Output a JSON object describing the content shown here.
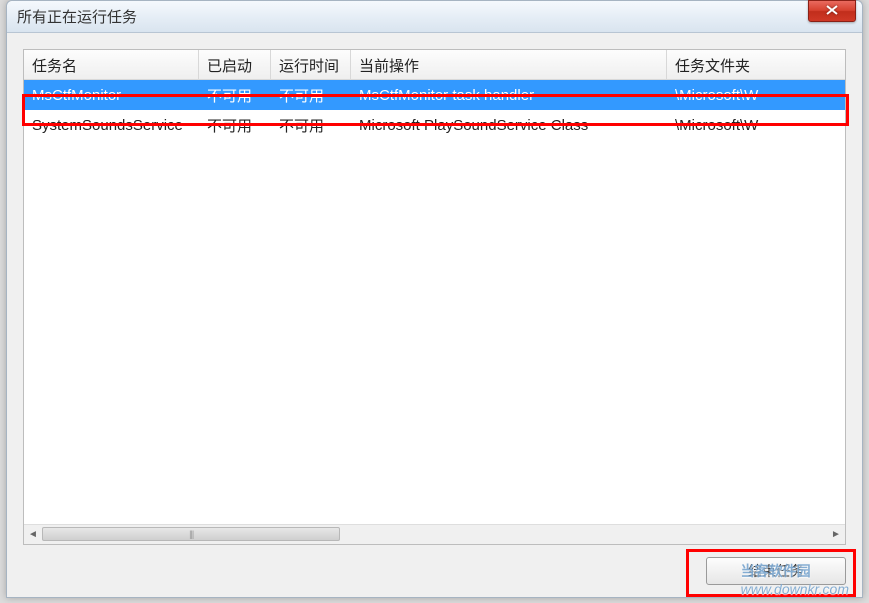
{
  "window": {
    "title": "所有正在运行任务"
  },
  "columns": {
    "name": "任务名",
    "started": "已启动",
    "runtime": "运行时间",
    "operation": "当前操作",
    "folder": "任务文件夹"
  },
  "rows": [
    {
      "name": "MsCtfMonitor",
      "started": "不可用",
      "runtime": "不可用",
      "operation": "MsCtfMonitor task handler",
      "folder": "\\Microsoft\\W",
      "selected": true
    },
    {
      "name": "SystemSoundsService",
      "started": "不可用",
      "runtime": "不可用",
      "operation": "Microsoft PlaySoundService Class",
      "folder": "\\Microsoft\\W",
      "selected": false
    }
  ],
  "buttons": {
    "end_task_label": "结束任务"
  },
  "watermark": {
    "line1": "当客软件园",
    "line2": "www.downkr.com"
  }
}
